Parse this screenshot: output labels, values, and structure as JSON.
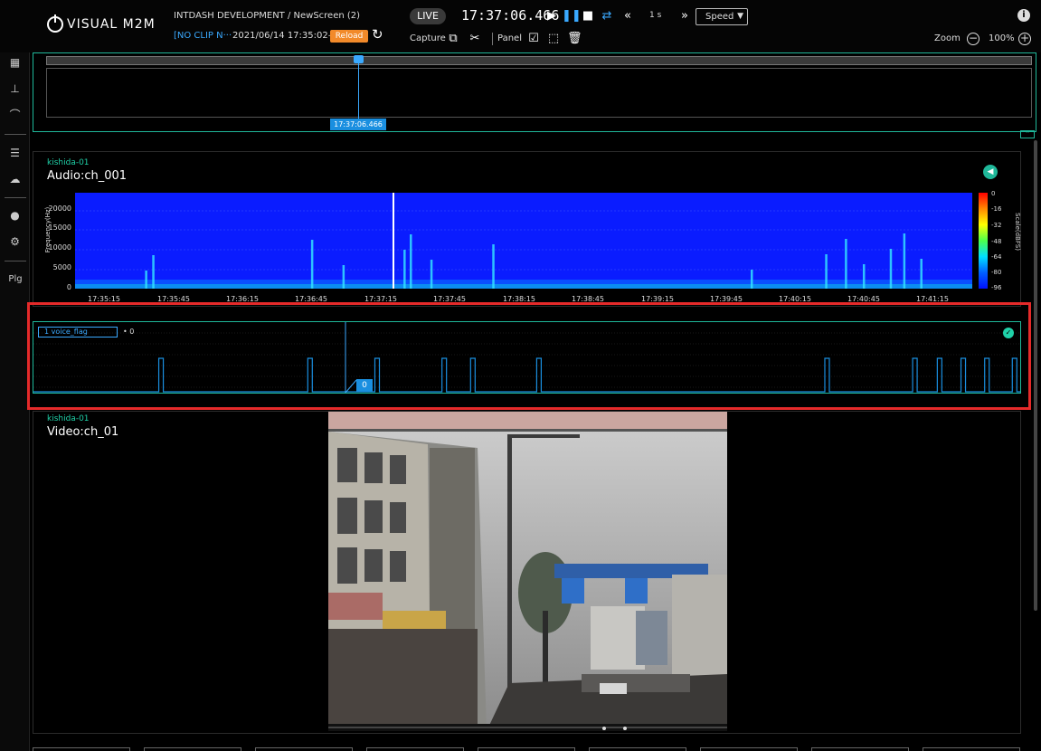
{
  "header": {
    "logo_text": "VISUAL M2M",
    "project_path": "INTDASH DEVELOPMENT / NewScreen (2)",
    "clip_label": "[NO CLIP N···",
    "date_label": "2021/06/14 17:35:02–",
    "reload_label": "Reload",
    "live_label": "LIVE",
    "clock": "17:37:06.466",
    "step_label": "1 s",
    "speed_label": "Speed",
    "capture_label": "Capture",
    "panel_label": "Panel",
    "zoom_label": "Zoom",
    "zoom_value": "100%"
  },
  "sidebar": {
    "plugin_label": "Plg"
  },
  "timeline": {
    "cursor_time": "17:37:06.466"
  },
  "audio_panel": {
    "device": "kishida-01",
    "channel": "Audio:ch_001",
    "y_axis_title": "Frequency(Hz)",
    "y_ticks": [
      "20000",
      "15000",
      "10000",
      "5000",
      "0"
    ],
    "x_ticks": [
      "17:35:15",
      "17:35:45",
      "17:36:15",
      "17:36:45",
      "17:37:15",
      "17:37:45",
      "17:38:15",
      "17:38:45",
      "17:39:15",
      "17:39:45",
      "17:40:15",
      "17:40:45",
      "17:41:15"
    ],
    "colorbar_title": "Scale(dBFS)",
    "colorbar_ticks": [
      "0",
      "-16",
      "-32",
      "-48",
      "-64",
      "-80",
      "-96"
    ],
    "colors": {
      "background": "#0a1cff",
      "cursor": "#ffffff"
    }
  },
  "flag_panel": {
    "legend_label": "1 voice_flag",
    "legend_value": "0",
    "current_value": "0",
    "pulse_positions": [
      0.127,
      0.278,
      0.346,
      0.414,
      0.443,
      0.51,
      0.802,
      0.891,
      0.916,
      0.94,
      0.964,
      0.992
    ]
  },
  "video_panel": {
    "device": "kishida-01",
    "channel": "Video:ch_01"
  }
}
